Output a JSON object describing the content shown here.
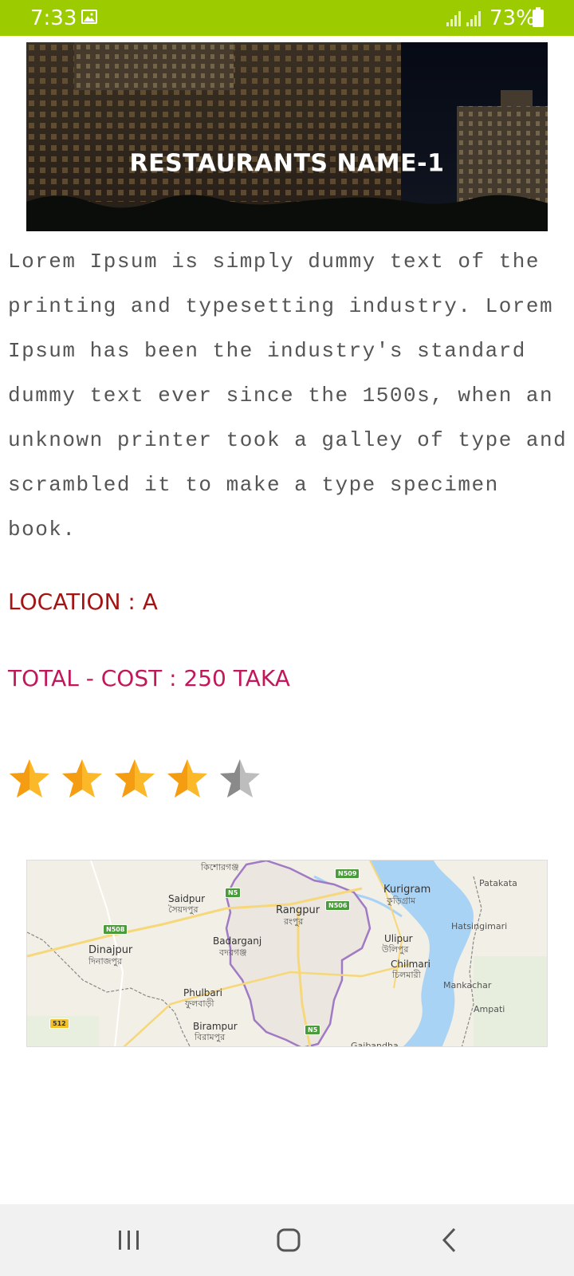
{
  "status_bar": {
    "time": "7:33",
    "battery": "73%",
    "icons": [
      "gallery-icon",
      "signal-icon",
      "battery-icon"
    ]
  },
  "banner": {
    "title": "RESTAURANTS NAME-1"
  },
  "description": "Lorem Ipsum is simply dummy text of the printing and typesetting industry. Lorem Ipsum has been the industry's standard dummy text ever since the 1500s, when an unknown printer took a galley of type and scrambled it to make a type specimen book.",
  "location": "LOCATION : A",
  "total_cost": "TOTAL - COST : 250 TAKA",
  "rating": {
    "value": 4.5,
    "max": 5
  },
  "map": {
    "labels": {
      "kishoreganj_bn": "কিশোরগঞ্জ",
      "saidpur": "Saidpur",
      "saidpur_bn": "সৈয়দপুর",
      "rangpur": "Rangpur",
      "rangpur_bn": "রংপুর",
      "kurigram": "Kurigram",
      "kurigram_bn": "কুড়িগ্রাম",
      "patakata": "Patakata",
      "hatsingimari": "Hatsingimari",
      "dinajpur": "Dinajpur",
      "dinajpur_bn": "দিনাজপুর",
      "badarganj": "Badarganj",
      "badarganj_bn": "বদরগঞ্জ",
      "ulipur": "Ulipur",
      "ulipur_bn": "উলিপুর",
      "chilmari": "Chilmari",
      "chilmari_bn": "চিলমারী",
      "mankachar": "Mankachar",
      "phulbari": "Phulbari",
      "phulbari_bn": "ফুলবাড়ী",
      "ampati": "Ampati",
      "birampur": "Birampur",
      "birampur_bn": "বিরামপুর",
      "gaibandha": "Gaibandha"
    },
    "roads": [
      "N509",
      "N5",
      "N506",
      "N508",
      "N5",
      "512"
    ]
  },
  "nav_bar": {
    "buttons": [
      "recent-apps-icon",
      "home-icon",
      "back-icon"
    ]
  },
  "colors": {
    "status_bar": "#9ccc00",
    "location": "#a31515",
    "total_cost": "#c2185b",
    "star": "#fbb829",
    "star_empty": "#9e9e9e"
  }
}
